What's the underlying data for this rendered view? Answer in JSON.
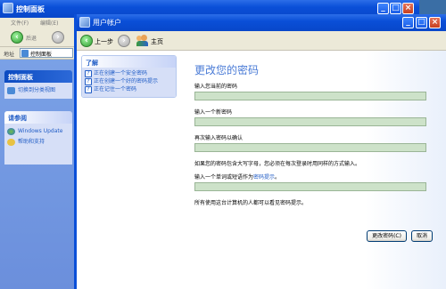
{
  "back_window": {
    "title": "控制面板",
    "menu": [
      "文件(F)",
      "编辑(E)"
    ],
    "toolbar": {
      "back_label": "后退"
    },
    "address": {
      "label": "地址",
      "value": "控制面板"
    },
    "sidebar": {
      "panel1": {
        "title": "控制面板",
        "item": "切换到分类视图"
      },
      "panel2": {
        "title": "请参阅",
        "items": [
          "Windows Update",
          "帮助和支持"
        ]
      }
    }
  },
  "front_window": {
    "title": "用户帐户",
    "nav": {
      "back_label": "上一步",
      "home_label": "主页"
    },
    "learn": {
      "title": "了解",
      "items": [
        "正在创建一个安全密码",
        "正在创建一个好的密码提示",
        "正在记住一个密码"
      ]
    },
    "main": {
      "heading": "更改您的密码",
      "current_label": "输入您当前的密码",
      "new_label": "输入一个新密码",
      "confirm_label": "再次输入密码以确认",
      "case_note": "如果您的密码包含大写字母，您必须在每次登录时用同样的方式输入。",
      "hint_label_prefix": "输入一个单词或短语作为",
      "hint_link": "密码提示",
      "hint_label_suffix": "。",
      "visible_note": "所有使用这台计算机的人都可以看见密码提示。",
      "change_button": "更改密码(C)",
      "cancel_button": "取消"
    }
  }
}
